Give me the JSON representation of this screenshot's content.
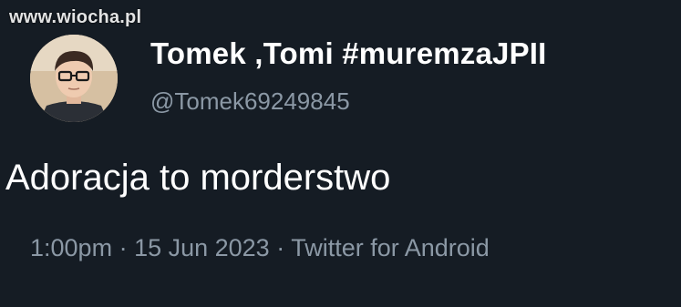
{
  "watermark": "www.wiocha.pl",
  "tweet": {
    "author": {
      "display_name": "Tomek ,Tomi #muremzaJPII",
      "handle": "@Tomek69249845"
    },
    "text": "Adoracja to morderstwo",
    "meta": {
      "time": "1:00pm",
      "separator": " · ",
      "date": "15 Jun 2023",
      "source": "Twitter for Android"
    }
  }
}
